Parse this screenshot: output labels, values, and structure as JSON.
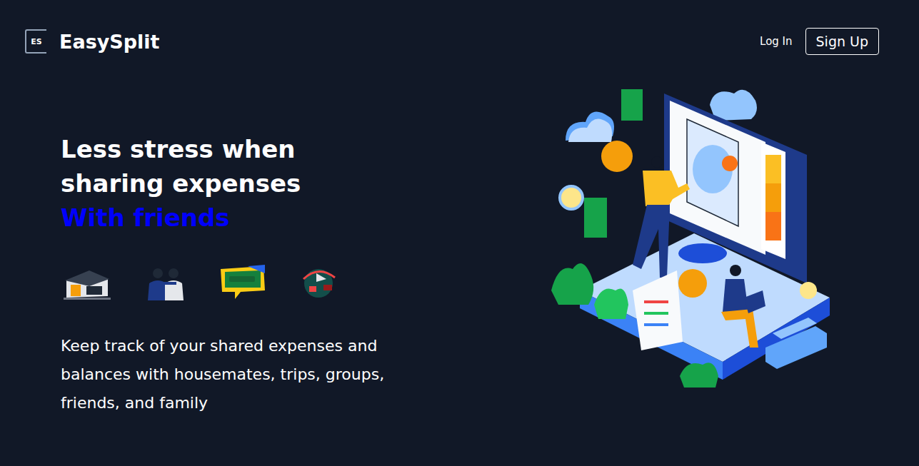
{
  "header": {
    "logo_mark": "ES",
    "brand": "EasySplit",
    "nav": [
      {
        "label": "Log In",
        "kind": "link"
      },
      {
        "label": "Sign Up",
        "kind": "button"
      }
    ]
  },
  "hero": {
    "headline": [
      "Less stress when",
      "sharing expenses"
    ],
    "highlight": "With friends",
    "description": "Keep track of your shared expenses and balances with housemates, trips, groups, friends, and family"
  }
}
